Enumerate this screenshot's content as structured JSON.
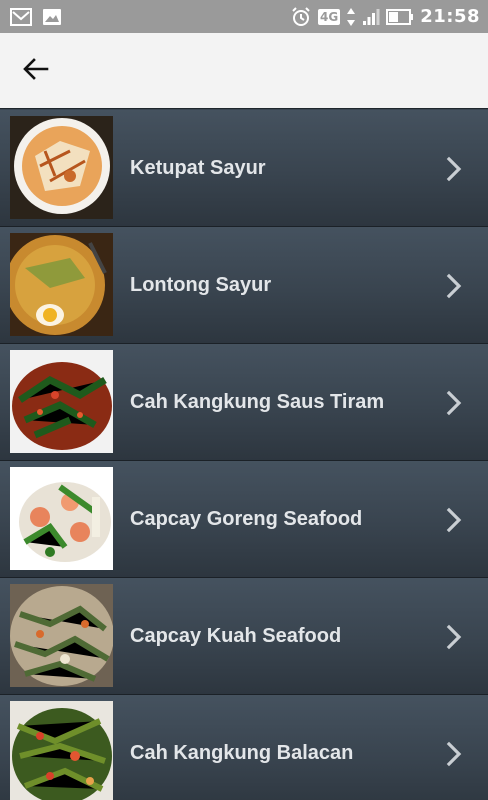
{
  "status_bar": {
    "network": "4G",
    "time": "21:58",
    "icons": [
      "gmail-icon",
      "gallery-icon",
      "alarm-icon",
      "data-arrows-icon",
      "signal-icon",
      "battery-icon"
    ]
  },
  "app_bar": {
    "back_icon": "arrow-left-icon"
  },
  "menu_items": [
    {
      "label": "Ketupat Sayur"
    },
    {
      "label": "Lontong Sayur"
    },
    {
      "label": "Cah Kangkung Saus Tiram"
    },
    {
      "label": "Capcay Goreng Seafood"
    },
    {
      "label": "Capcay Kuah Seafood"
    },
    {
      "label": "Cah Kangkung Balacan"
    }
  ],
  "colors": {
    "status_bar": "#9a9a9a",
    "app_bar": "#f3f3f3",
    "list_bg": "#3a4652",
    "label_text": "#e3e6e9",
    "chevron": "#c9ced3"
  }
}
